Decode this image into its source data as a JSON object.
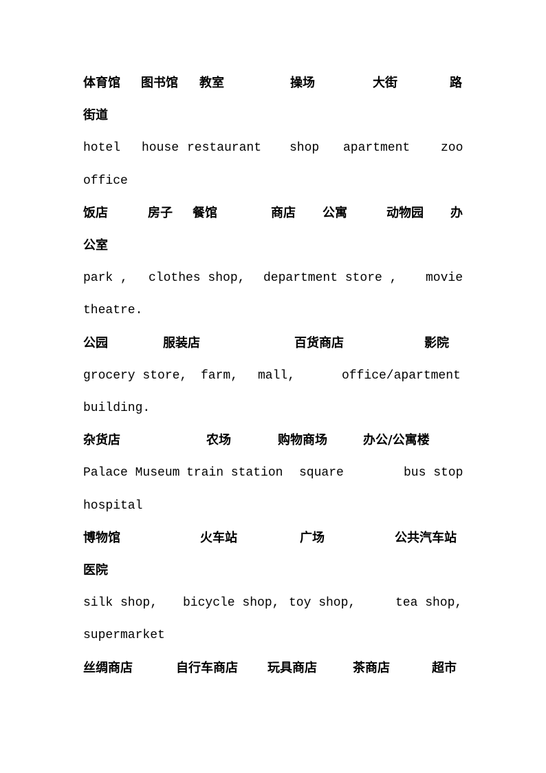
{
  "document": {
    "lines": [
      {
        "lang": "zh",
        "words": [
          "体育馆",
          "图书馆",
          "教室",
          "操场",
          "大街",
          "路"
        ]
      },
      {
        "lang": "zh",
        "words": [
          "街道"
        ]
      },
      {
        "lang": "en",
        "words": [
          "hotel",
          "house",
          "restaurant",
          "shop",
          "apartment",
          "zoo"
        ]
      },
      {
        "lang": "en",
        "words": [
          "office"
        ]
      },
      {
        "lang": "zh",
        "words": [
          "饭店",
          "房子",
          "餐馆",
          "商店",
          "公寓",
          "动物园",
          "办"
        ]
      },
      {
        "lang": "zh",
        "words": [
          "公室"
        ]
      },
      {
        "lang": "en",
        "words": [
          "park ,",
          "clothes shop,",
          "department store ,",
          "movie"
        ]
      },
      {
        "lang": "en",
        "words": [
          "theatre."
        ]
      },
      {
        "lang": "zh",
        "words": [
          "公园",
          "服装店",
          "百货商店",
          "影院"
        ]
      },
      {
        "lang": "en",
        "words": [
          "grocery store,",
          "farm,",
          "mall,",
          "office/apartment"
        ]
      },
      {
        "lang": "en",
        "words": [
          "building."
        ]
      },
      {
        "lang": "zh",
        "words": [
          "杂货店",
          "农场",
          "购物商场",
          "办公/公寓楼"
        ]
      },
      {
        "lang": "en",
        "words": [
          "Palace Museum",
          "train station",
          "square",
          "bus stop"
        ]
      },
      {
        "lang": "en",
        "words": [
          "hospital"
        ]
      },
      {
        "lang": "zh",
        "words": [
          "博物馆",
          "火车站",
          "广场",
          "公共汽车站"
        ]
      },
      {
        "lang": "zh",
        "words": [
          "医院"
        ]
      },
      {
        "lang": "en",
        "words": [
          "silk shop,",
          "bicycle shop,",
          "toy shop,",
          "tea shop,"
        ]
      },
      {
        "lang": "en",
        "words": [
          "supermarket"
        ]
      },
      {
        "lang": "zh",
        "words": [
          "丝绸商店",
          "自行车商店",
          "玩具商店",
          "茶商店",
          "超市"
        ]
      }
    ]
  }
}
